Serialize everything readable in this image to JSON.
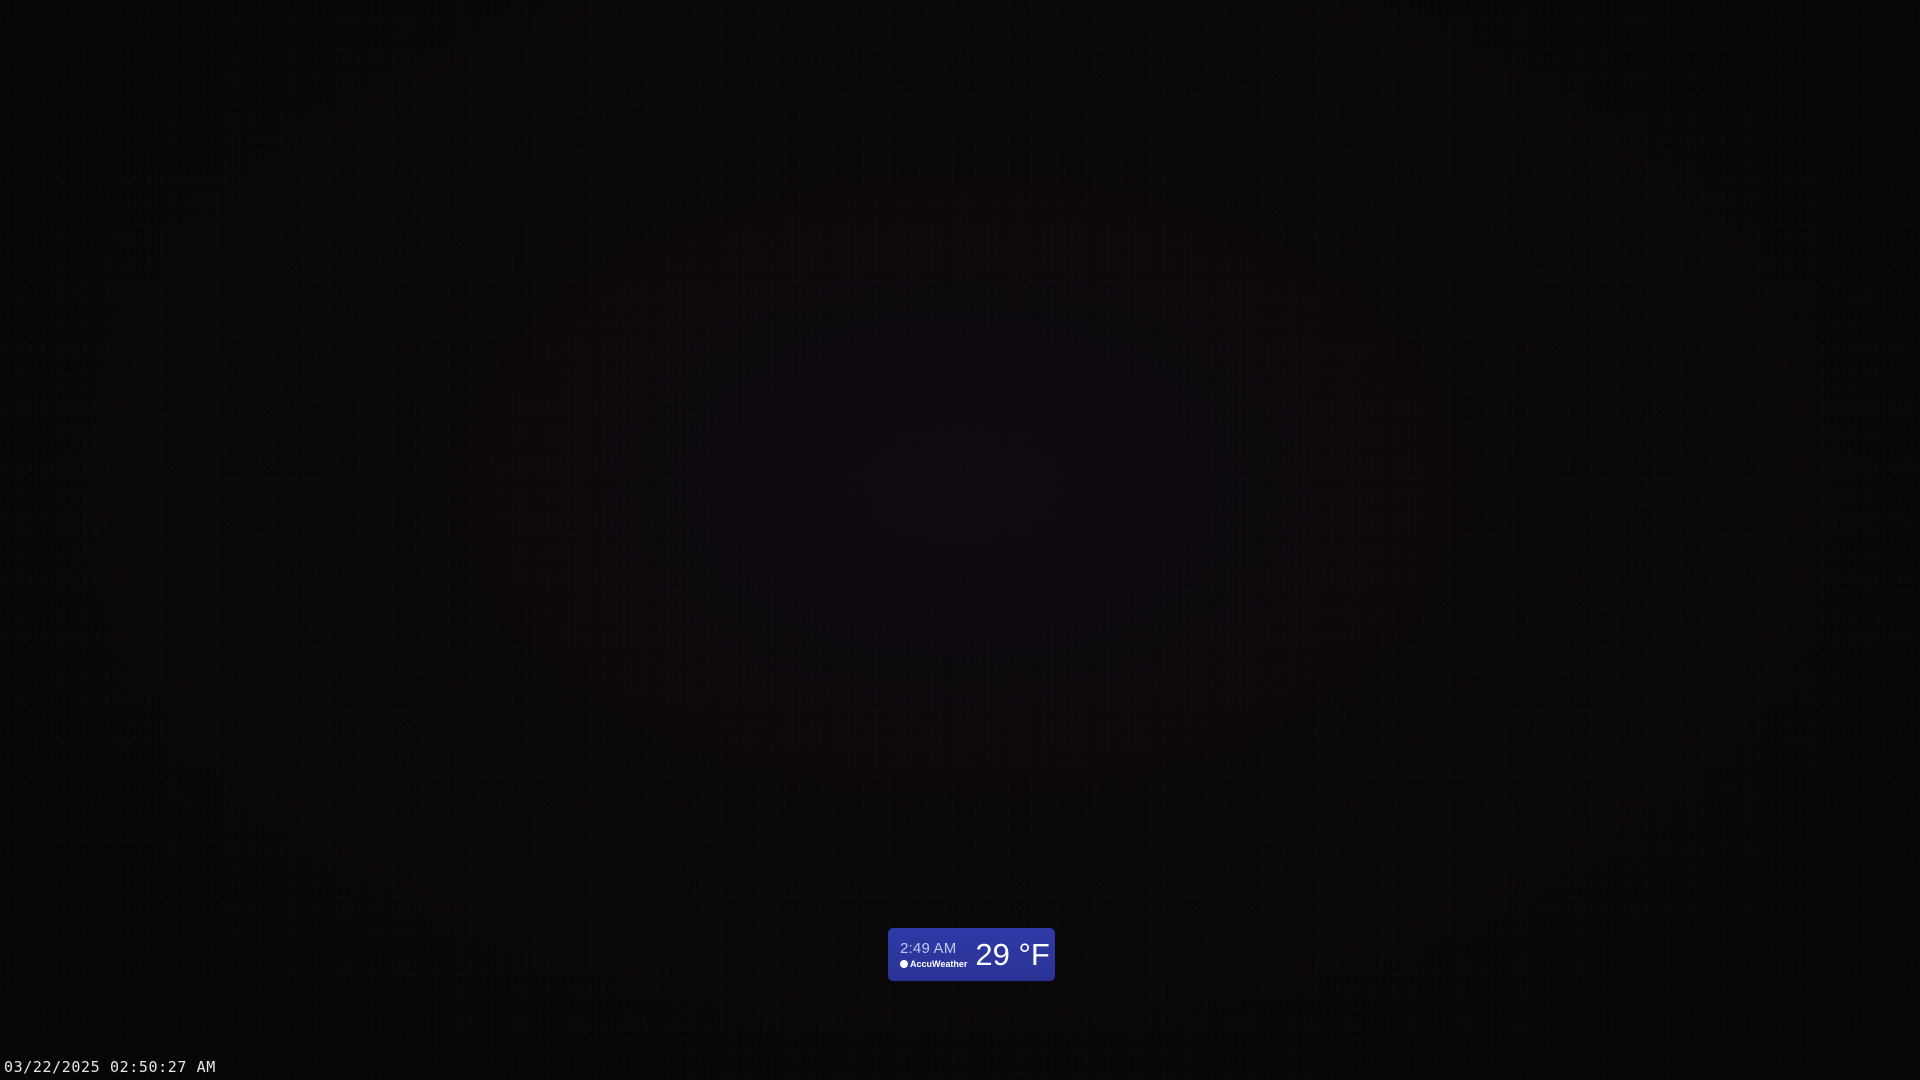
{
  "camera": {
    "timestamp": "03/22/2025 02:50:27 AM"
  },
  "weather_widget": {
    "time": "2:49 AM",
    "brand": "AccuWeather",
    "temperature": "29 °F",
    "background_color": "#2e3aa6"
  },
  "icons": {
    "brand_logo": "accuweather-sun-icon"
  }
}
